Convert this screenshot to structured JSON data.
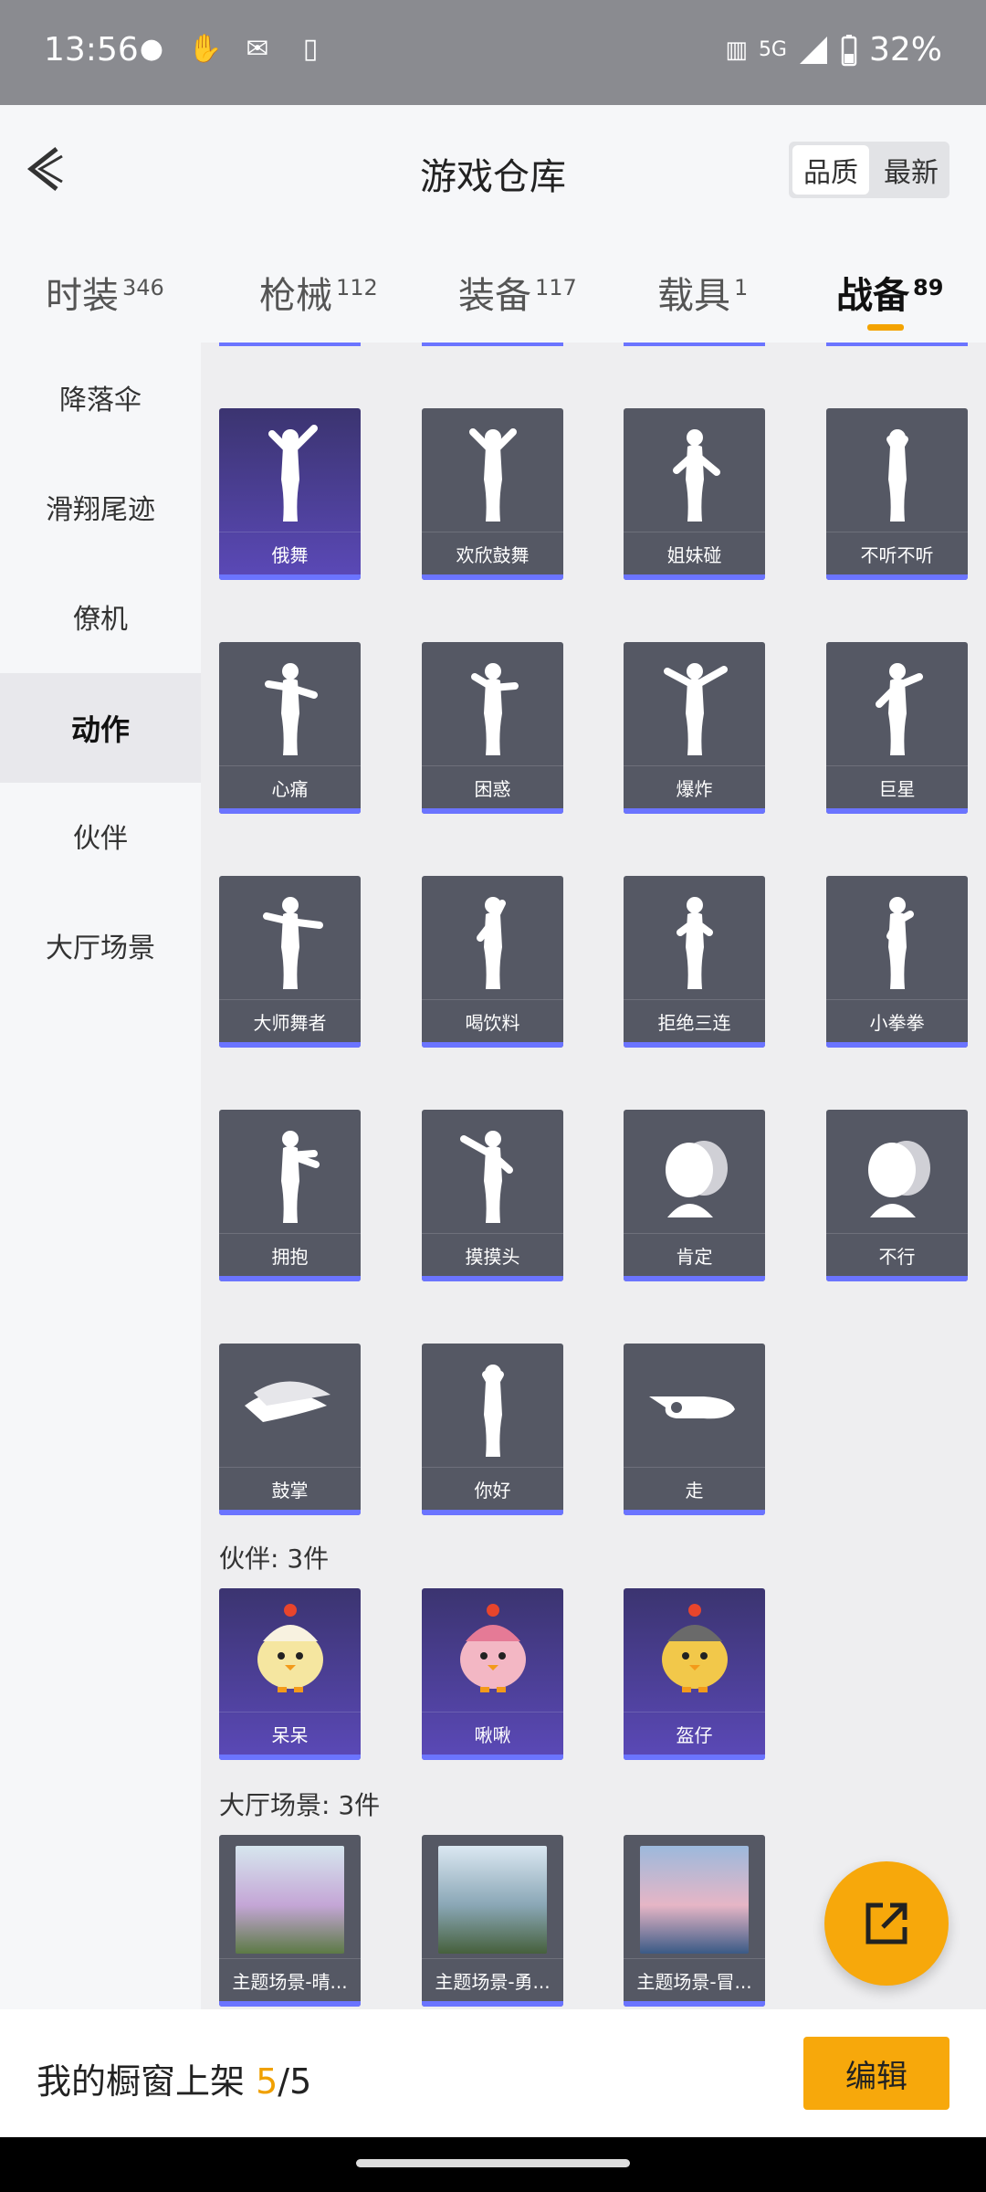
{
  "status": {
    "time": "13:56",
    "network": "5G",
    "battery": "32%",
    "left_icons": [
      "wechat-icon",
      "hand-icon",
      "mail-icon",
      "phone-sync-icon"
    ]
  },
  "header": {
    "title": "游戏仓库",
    "toggle": [
      "品质",
      "最新"
    ],
    "toggle_selected": "品质"
  },
  "tabs": [
    {
      "label": "时装",
      "count": "346"
    },
    {
      "label": "枪械",
      "count": "112"
    },
    {
      "label": "装备",
      "count": "117"
    },
    {
      "label": "载具",
      "count": "1"
    },
    {
      "label": "战备",
      "count": "89",
      "active": true
    }
  ],
  "sidebar": [
    {
      "label": "降落伞"
    },
    {
      "label": "滑翔尾迹"
    },
    {
      "label": "僚机"
    },
    {
      "label": "动作",
      "active": true
    },
    {
      "label": "伙伴"
    },
    {
      "label": "大厅场景"
    }
  ],
  "actions": [
    {
      "label": "俄舞",
      "rarity": "purple",
      "icon": "dance-figure-icon"
    },
    {
      "label": "欢欣鼓舞",
      "rarity": "gray",
      "icon": "cheer-figure-icon"
    },
    {
      "label": "姐妹碰",
      "rarity": "gray",
      "icon": "bump-figure-icon"
    },
    {
      "label": "不听不听",
      "rarity": "gray",
      "icon": "cover-ears-figure-icon"
    },
    {
      "label": "心痛",
      "rarity": "gray",
      "icon": "heartache-figure-icon"
    },
    {
      "label": "困惑",
      "rarity": "gray",
      "icon": "confused-figure-icon"
    },
    {
      "label": "爆炸",
      "rarity": "gray",
      "icon": "explode-figure-icon"
    },
    {
      "label": "巨星",
      "rarity": "gray",
      "icon": "superstar-figure-icon"
    },
    {
      "label": "大师舞者",
      "rarity": "gray",
      "icon": "master-dancer-figure-icon"
    },
    {
      "label": "喝饮料",
      "rarity": "gray",
      "icon": "drink-figure-icon"
    },
    {
      "label": "拒绝三连",
      "rarity": "gray",
      "icon": "refuse-figure-icon"
    },
    {
      "label": "小拳拳",
      "rarity": "gray",
      "icon": "punch-figure-icon"
    },
    {
      "label": "拥抱",
      "rarity": "gray",
      "icon": "hug-figure-icon"
    },
    {
      "label": "摸摸头",
      "rarity": "gray",
      "icon": "pat-head-figure-icon"
    },
    {
      "label": "肯定",
      "rarity": "gray",
      "icon": "nod-head-icon"
    },
    {
      "label": "不行",
      "rarity": "gray",
      "icon": "shake-head-icon"
    },
    {
      "label": "鼓掌",
      "rarity": "gray",
      "icon": "clap-hands-icon"
    },
    {
      "label": "你好",
      "rarity": "gray",
      "icon": "wave-figure-icon"
    },
    {
      "label": "走",
      "rarity": "gray",
      "icon": "point-hand-icon"
    }
  ],
  "partners": {
    "title": "伙伴: 3件",
    "items": [
      {
        "label": "呆呆",
        "icon": "chick-pet-icon"
      },
      {
        "label": "啾啾",
        "icon": "pink-bird-pet-icon"
      },
      {
        "label": "盔仔",
        "icon": "helmet-chick-pet-icon"
      }
    ]
  },
  "scenes": {
    "title": "大厅场景: 3件",
    "items": [
      {
        "label": "主题场景-晴...",
        "icon": "scene-meadow-thumb"
      },
      {
        "label": "主题场景-勇...",
        "icon": "scene-mountain-thumb"
      },
      {
        "label": "主题场景-冒...",
        "icon": "scene-sea-thumb"
      }
    ]
  },
  "bottom": {
    "prefix": "我的橱窗上架 ",
    "current": "5",
    "total": "/5",
    "edit_label": "编辑"
  },
  "colors": {
    "accent": "#f7a80b",
    "card_bar": "#6b74ff",
    "purple_card": "#5b49b8"
  }
}
